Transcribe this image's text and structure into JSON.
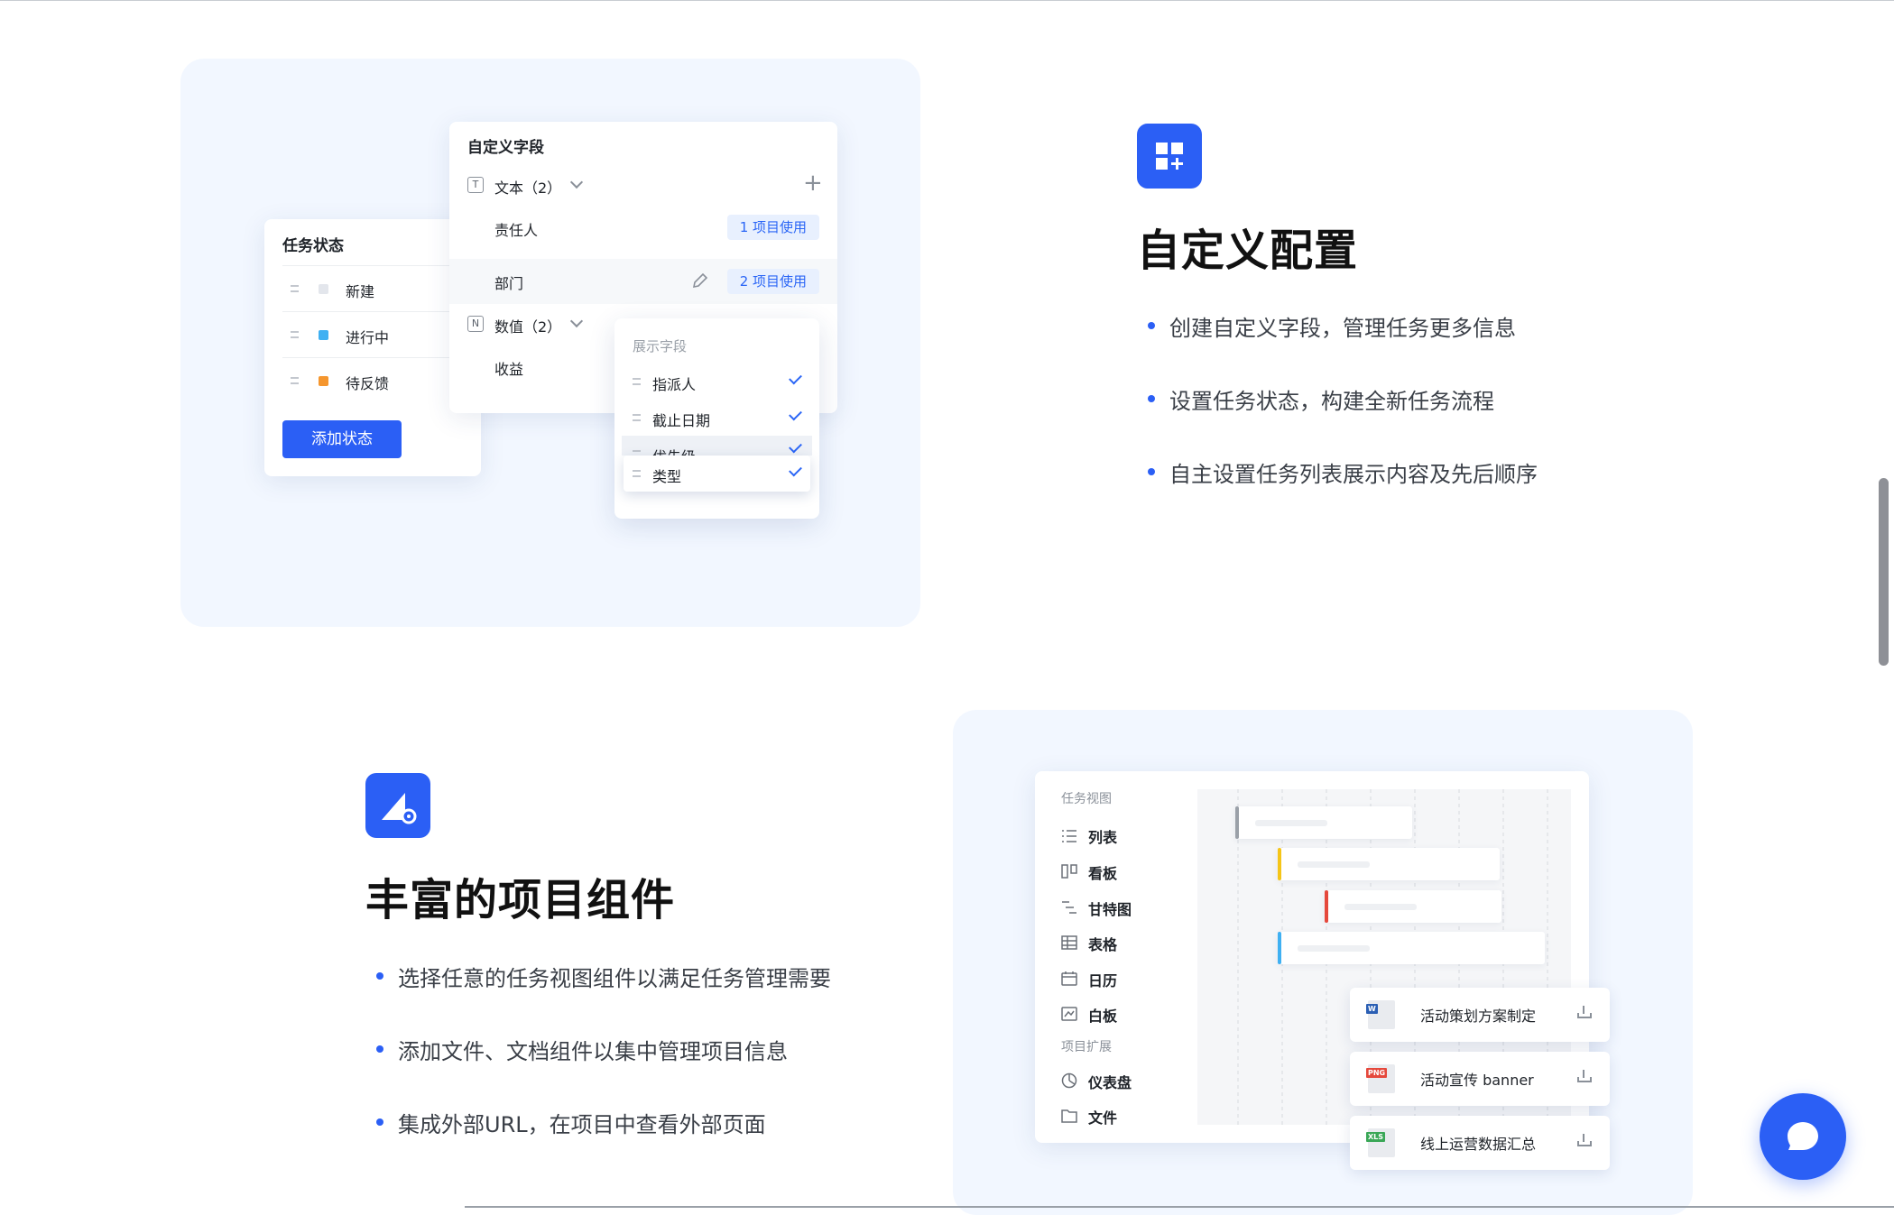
{
  "section1": {
    "status_card": {
      "title": "任务状态",
      "items": [
        {
          "label": "新建",
          "color": "#e3e6ec"
        },
        {
          "label": "进行中",
          "color": "#3fb0f2"
        },
        {
          "label": "待反馈",
          "color": "#f5962e"
        }
      ],
      "add_button": "添加状态"
    },
    "custom_fields_card": {
      "title": "自定义字段",
      "groups": [
        {
          "icon_letter": "T",
          "label": "文本（2）",
          "rows": [
            {
              "label": "责任人",
              "badge": "1 项目使用"
            },
            {
              "label": "部门",
              "badge": "2 项目使用"
            }
          ]
        },
        {
          "icon_letter": "N",
          "label": "数值（2）",
          "rows": [
            {
              "label": "收益"
            }
          ]
        }
      ]
    },
    "display_fields_card": {
      "title": "展示字段",
      "items": [
        "指派人",
        "截止日期",
        "优先级"
      ],
      "dragging_item": "类型"
    },
    "feature": {
      "title": "自定义配置",
      "bullets": [
        "创建自定义字段，管理任务更多信息",
        "设置任务状态，构建全新任务流程",
        "自主设置任务列表展示内容及先后顺序"
      ]
    }
  },
  "section2": {
    "feature": {
      "title": "丰富的项目组件",
      "bullets": [
        "选择任意的任务视图组件以满足任务管理需要",
        "添加文件、文档组件以集中管理项目信息",
        "集成外部URL，在项目中查看外部页面"
      ]
    },
    "views_card": {
      "views_heading": "任务视图",
      "views": [
        {
          "icon": "list-icon",
          "label": "列表"
        },
        {
          "icon": "kanban-icon",
          "label": "看板"
        },
        {
          "icon": "gantt-icon",
          "label": "甘特图"
        },
        {
          "icon": "table-icon",
          "label": "表格"
        },
        {
          "icon": "calendar-icon",
          "label": "日历"
        },
        {
          "icon": "whiteboard-icon",
          "label": "白板"
        }
      ],
      "extensions_heading": "项目扩展",
      "extensions": [
        {
          "icon": "dashboard-icon",
          "label": "仪表盘"
        },
        {
          "icon": "folder-icon",
          "label": "文件"
        }
      ]
    },
    "gantt_bar_colors": [
      "#9aa0a8",
      "#f5c518",
      "#e5483c",
      "#3fb0f2"
    ],
    "files": [
      {
        "type": "W",
        "type_color": "#2b5fb4",
        "name": "活动策划方案制定"
      },
      {
        "type": "PNG",
        "type_color": "#e5483c",
        "name": "活动宣传 banner"
      },
      {
        "type": "XLS",
        "type_color": "#3aa757",
        "name": "线上运营数据汇总"
      }
    ]
  },
  "colors": {
    "accent": "#2b5ff5",
    "panel_bg": "#f2f7ff"
  }
}
